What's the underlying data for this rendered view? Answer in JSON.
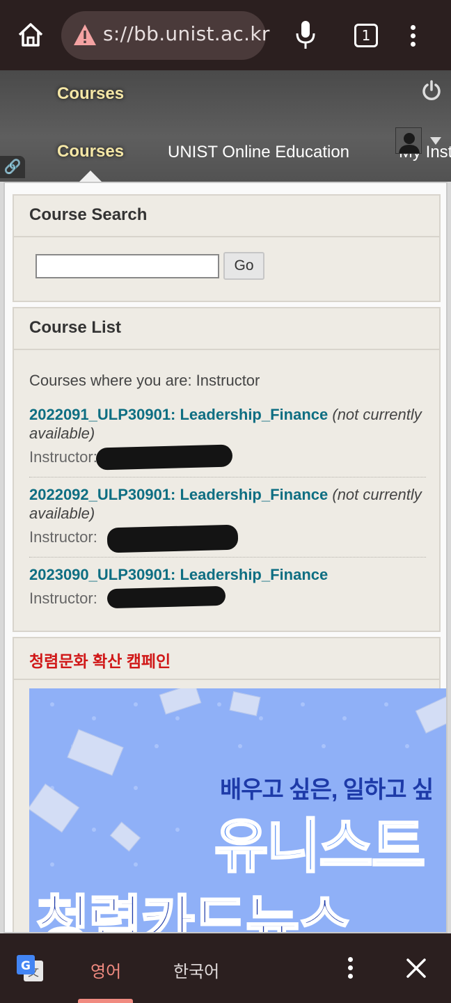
{
  "browser": {
    "url": "s://bb.unist.ac.kr",
    "tab_count": "1",
    "icons": [
      "home-icon",
      "warning-icon",
      "mic-icon",
      "tabs-icon",
      "menu-icon"
    ]
  },
  "header": {
    "brand": "Courses",
    "nav": [
      "Courses",
      "UNIST Online Education",
      "My Inst"
    ],
    "icons": [
      "power-icon",
      "avatar-icon",
      "link-icon"
    ]
  },
  "search": {
    "title": "Course Search",
    "input_value": "",
    "go_label": "Go"
  },
  "course_list": {
    "title": "Course List",
    "role_text": "Courses where you are: Instructor",
    "courses": [
      {
        "name": "2022091_ULP30901: Leadership_Finance",
        "note": "(not currently available)",
        "instructor_label": "Instructor:"
      },
      {
        "name": "2022092_ULP30901: Leadership_Finance",
        "note": "(not currently available)",
        "instructor_label": "Instructor:"
      },
      {
        "name": "2023090_ULP30901: Leadership_Finance",
        "note": "",
        "instructor_label": "Instructor:"
      }
    ]
  },
  "campaign": {
    "title": "청렴문화 확산 캠페인",
    "banner_line1": "배우고 싶은, 일하고 싶",
    "banner_line2": "유니스트",
    "banner_line3": "청렴카드뉴스"
  },
  "translate_bar": {
    "lang_source": "영어",
    "lang_target": "한국어",
    "icons": [
      "google-translate-icon",
      "menu-icon",
      "close-icon"
    ]
  },
  "colors": {
    "link": "#0e6e82",
    "brand": "#f5e7a6",
    "campaign_title": "#d01818",
    "chrome": "#2b1f1f",
    "active_lang": "#f08a80"
  }
}
